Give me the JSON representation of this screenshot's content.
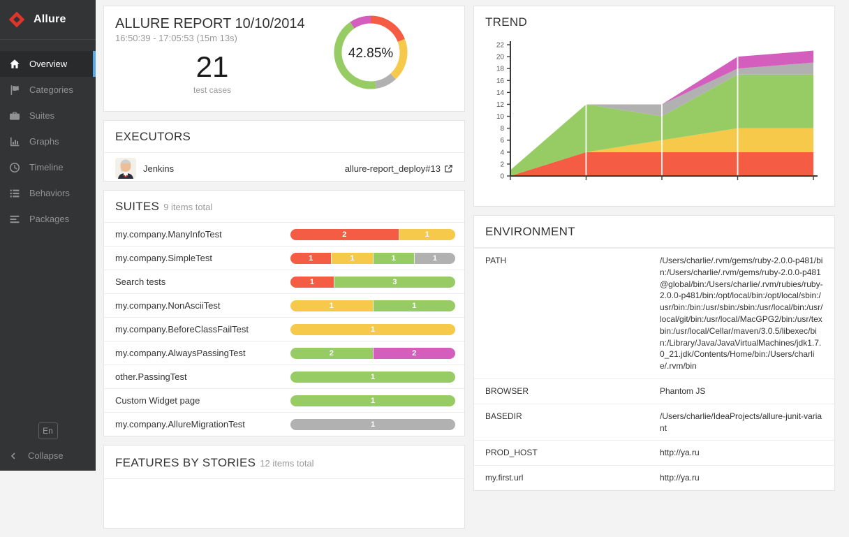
{
  "colors": {
    "accent": "#5aa7e8",
    "failed": "#f45c43",
    "broken": "#f7c94b",
    "passed": "#97cc64",
    "canceled": "#b1b1b1",
    "pending": "#d35ebe"
  },
  "sidebar": {
    "brand": "Allure",
    "items": [
      {
        "label": "Overview",
        "icon": "home-icon",
        "active": true
      },
      {
        "label": "Categories",
        "icon": "flag-icon",
        "active": false
      },
      {
        "label": "Suites",
        "icon": "briefcase-icon",
        "active": false
      },
      {
        "label": "Graphs",
        "icon": "bar-chart-icon",
        "active": false
      },
      {
        "label": "Timeline",
        "icon": "clock-icon",
        "active": false
      },
      {
        "label": "Behaviors",
        "icon": "list-icon",
        "active": false
      },
      {
        "label": "Packages",
        "icon": "align-left-icon",
        "active": false
      }
    ],
    "language": "En",
    "collapse_label": "Collapse"
  },
  "overview": {
    "title": "ALLURE REPORT 10/10/2014",
    "time_range": "16:50:39 - 17:05:53 (15m 13s)",
    "total": "21",
    "total_label": "test cases",
    "percent": "42.85%"
  },
  "executors": {
    "title": "EXECUTORS",
    "name": "Jenkins",
    "build": "allure-report_deploy#13"
  },
  "suites": {
    "title": "SUITES",
    "subtitle": "9 items total",
    "rows": [
      {
        "name": "my.company.ManyInfoTest",
        "segments": [
          {
            "status": "failed",
            "count": 2
          },
          {
            "status": "broken",
            "count": 1
          }
        ]
      },
      {
        "name": "my.company.SimpleTest",
        "segments": [
          {
            "status": "failed",
            "count": 1
          },
          {
            "status": "broken",
            "count": 1
          },
          {
            "status": "passed",
            "count": 1
          },
          {
            "status": "canceled",
            "count": 1
          }
        ]
      },
      {
        "name": "Search tests",
        "segments": [
          {
            "status": "failed",
            "count": 1
          },
          {
            "status": "passed",
            "count": 3
          }
        ]
      },
      {
        "name": "my.company.NonAsciiTest",
        "segments": [
          {
            "status": "broken",
            "count": 1
          },
          {
            "status": "passed",
            "count": 1
          }
        ]
      },
      {
        "name": "my.company.BeforeClassFailTest",
        "segments": [
          {
            "status": "broken",
            "count": 1
          }
        ]
      },
      {
        "name": "my.company.AlwaysPassingTest",
        "segments": [
          {
            "status": "passed",
            "count": 2
          },
          {
            "status": "pending",
            "count": 2
          }
        ]
      },
      {
        "name": "other.PassingTest",
        "segments": [
          {
            "status": "passed",
            "count": 1
          }
        ]
      },
      {
        "name": "Custom Widget page",
        "segments": [
          {
            "status": "passed",
            "count": 1
          }
        ]
      },
      {
        "name": "my.company.AllureMigrationTest",
        "segments": [
          {
            "status": "canceled",
            "count": 1
          }
        ]
      }
    ]
  },
  "features": {
    "title": "FEATURES BY STORIES",
    "subtitle": "12 items total"
  },
  "trend": {
    "title": "TREND"
  },
  "environment": {
    "title": "ENVIRONMENT",
    "rows": [
      {
        "name": "PATH",
        "value": "/Users/charlie/.rvm/gems/ruby-2.0.0-p481/bin:/Users/charlie/.rvm/gems/ruby-2.0.0-p481@global/bin:/Users/charlie/.rvm/rubies/ruby-2.0.0-p481/bin:/opt/local/bin:/opt/local/sbin:/usr/bin:/bin:/usr/sbin:/sbin:/usr/local/bin:/usr/local/git/bin:/usr/local/MacGPG2/bin:/usr/texbin:/usr/local/Cellar/maven/3.0.5/libexec/bin:/Library/Java/JavaVirtualMachines/jdk1.7.0_21.jdk/Contents/Home/bin:/Users/charlie/.rvm/bin"
      },
      {
        "name": "BROWSER",
        "value": "Phantom JS"
      },
      {
        "name": "BASEDIR",
        "value": "/Users/charlie/IdeaProjects/allure-junit-variant"
      },
      {
        "name": "PROD_HOST",
        "value": "http://ya.ru"
      },
      {
        "name": "my.first.url",
        "value": "http://ya.ru"
      }
    ]
  },
  "chart_data": [
    {
      "type": "pie",
      "title": "test cases status ratio",
      "center_label": "42.85%",
      "slices": [
        {
          "label": "failed",
          "value": 4
        },
        {
          "label": "broken",
          "value": 4
        },
        {
          "label": "canceled",
          "value": 2
        },
        {
          "label": "passed",
          "value": 9
        },
        {
          "label": "pending",
          "value": 2
        }
      ]
    },
    {
      "type": "area",
      "title": "TREND",
      "stacked": true,
      "x": [
        0,
        1,
        2,
        3,
        4
      ],
      "ylim": [
        0,
        22
      ],
      "yticks": [
        0,
        2,
        4,
        6,
        8,
        10,
        12,
        14,
        16,
        18,
        20,
        22
      ],
      "grid": "vertical-white-lines-at-inner-points",
      "legend": "none",
      "series": [
        {
          "name": "failed",
          "values": [
            0,
            4,
            4,
            4,
            4
          ]
        },
        {
          "name": "broken",
          "values": [
            0,
            0,
            2,
            4,
            4
          ]
        },
        {
          "name": "passed",
          "values": [
            1,
            8,
            4,
            9,
            9
          ]
        },
        {
          "name": "canceled",
          "values": [
            0,
            0,
            2,
            1,
            2
          ]
        },
        {
          "name": "pending",
          "values": [
            0,
            0,
            0,
            2,
            2
          ]
        }
      ],
      "totals": [
        1,
        12,
        12,
        20,
        21
      ]
    }
  ]
}
